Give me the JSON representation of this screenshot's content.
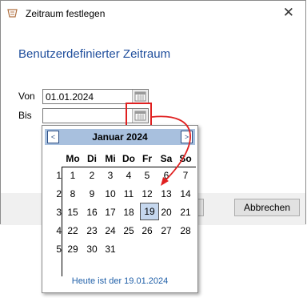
{
  "window": {
    "title": "Zeitraum festlegen",
    "close_glyph": "✕"
  },
  "heading": "Benutzerdefinierter Zeitraum",
  "from": {
    "label": "Von",
    "value": "01.01.2024"
  },
  "to": {
    "label": "Bis",
    "value": ""
  },
  "buttons": {
    "ok": "",
    "cancel": "Abbrechen"
  },
  "calendar": {
    "prev": "<",
    "next": ">",
    "month": "Januar 2024",
    "weekdays": [
      "Mo",
      "Di",
      "Mi",
      "Do",
      "Fr",
      "Sa",
      "So"
    ],
    "weeks": [
      {
        "no": "1",
        "days": [
          "1",
          "2",
          "3",
          "4",
          "5",
          "6",
          "7"
        ]
      },
      {
        "no": "2",
        "days": [
          "8",
          "9",
          "10",
          "11",
          "12",
          "13",
          "14"
        ]
      },
      {
        "no": "3",
        "days": [
          "15",
          "16",
          "17",
          "18",
          "19",
          "20",
          "21"
        ]
      },
      {
        "no": "4",
        "days": [
          "22",
          "23",
          "24",
          "25",
          "26",
          "27",
          "28"
        ]
      },
      {
        "no": "5",
        "days": [
          "29",
          "30",
          "31",
          "",
          "",
          "",
          ""
        ]
      }
    ],
    "today_label": "Heute ist der 19.01.2024",
    "selected_day": "19"
  },
  "colors": {
    "accent": "#1f4e9c",
    "header": "#a8c0de",
    "highlight": "#e02020"
  }
}
